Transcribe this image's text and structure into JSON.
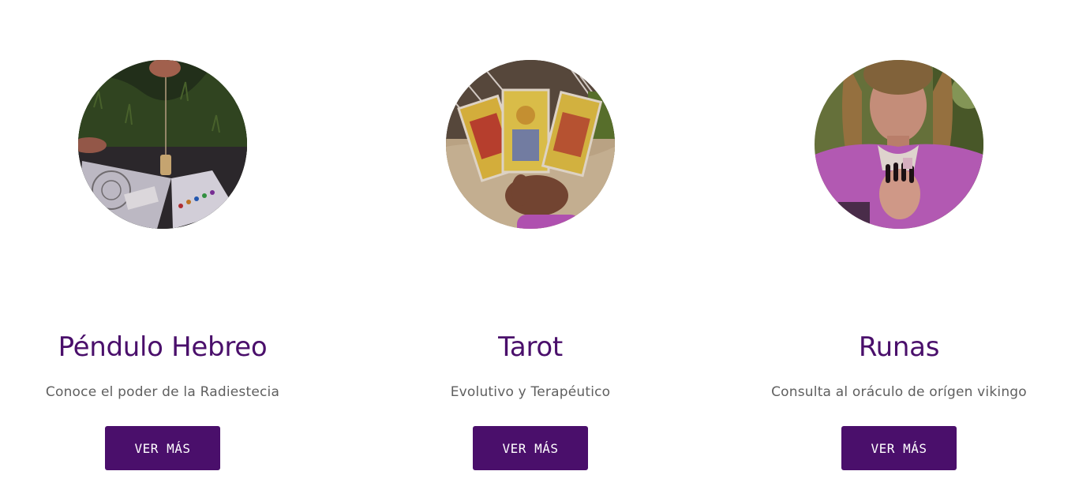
{
  "services": [
    {
      "title": "Péndulo Hebreo",
      "subtitle": "Conoce el poder de la Radiestecia",
      "button_label": "VER MÁS",
      "image": "pendulum-over-chart-photo"
    },
    {
      "title": "Tarot",
      "subtitle": "Evolutivo y Terapéutico",
      "button_label": "VER MÁS",
      "image": "hands-holding-tarot-cards-photo"
    },
    {
      "title": "Runas",
      "subtitle": "Consulta al oráculo de orígen vikingo",
      "button_label": "VER MÁS",
      "image": "woman-holding-crystal-photo"
    }
  ],
  "colors": {
    "accent": "#4a0f6b",
    "body_text": "#5f5f5f",
    "background": "#ffffff"
  }
}
